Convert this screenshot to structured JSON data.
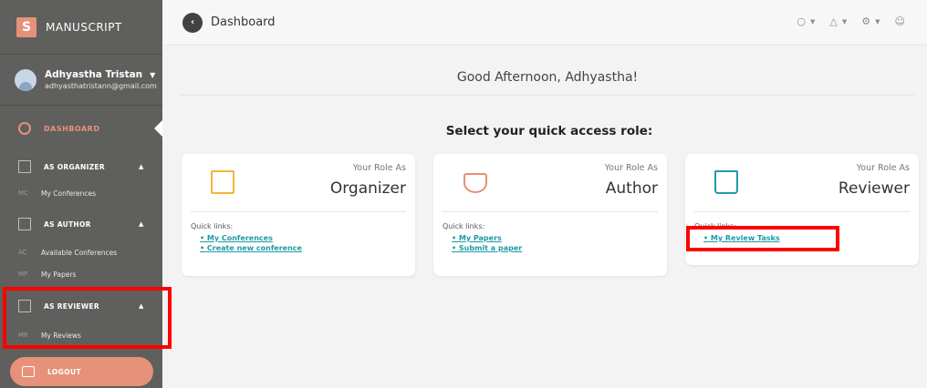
{
  "app": {
    "brand_logo": "S",
    "brand_name": "MANUSCRIPT"
  },
  "user": {
    "name": "Adhyastha Tristan",
    "email": "adhyasthatristann@gmail.com"
  },
  "sidebar": {
    "dashboard_label": "DASHBOARD",
    "sections": [
      {
        "label": "AS ORGANIZER",
        "items": [
          {
            "abbr": "MC",
            "label": "My Conferences"
          }
        ]
      },
      {
        "label": "AS AUTHOR",
        "items": [
          {
            "abbr": "AC",
            "label": "Available Conferences"
          },
          {
            "abbr": "MP",
            "label": "My Papers"
          }
        ]
      },
      {
        "label": "AS REVIEWER",
        "items": [
          {
            "abbr": "MR",
            "label": "My Reviews"
          }
        ]
      }
    ],
    "logout_label": "LOGOUT"
  },
  "topbar": {
    "title": "Dashboard",
    "back_glyph": "‹"
  },
  "main": {
    "greeting": "Good Afternoon, Adhyastha!",
    "select_title": "Select your quick access role:",
    "cards": [
      {
        "role_as": "Your Role As",
        "role": "Organizer",
        "quick_links_label": "Quick links:",
        "links": [
          "My Conferences",
          "Create new conference"
        ]
      },
      {
        "role_as": "Your Role As",
        "role": "Author",
        "quick_links_label": "Quick links:",
        "links": [
          "My Papers",
          "Submit a paper"
        ]
      },
      {
        "role_as": "Your Role As",
        "role": "Reviewer",
        "quick_links_label": "Quick links:",
        "links": [
          "My Review Tasks"
        ]
      }
    ]
  },
  "colors": {
    "accent": "#e7917a",
    "link": "#1e9aa5",
    "sidebar_bg": "#5f5f5d",
    "highlight": "#ff0000"
  }
}
